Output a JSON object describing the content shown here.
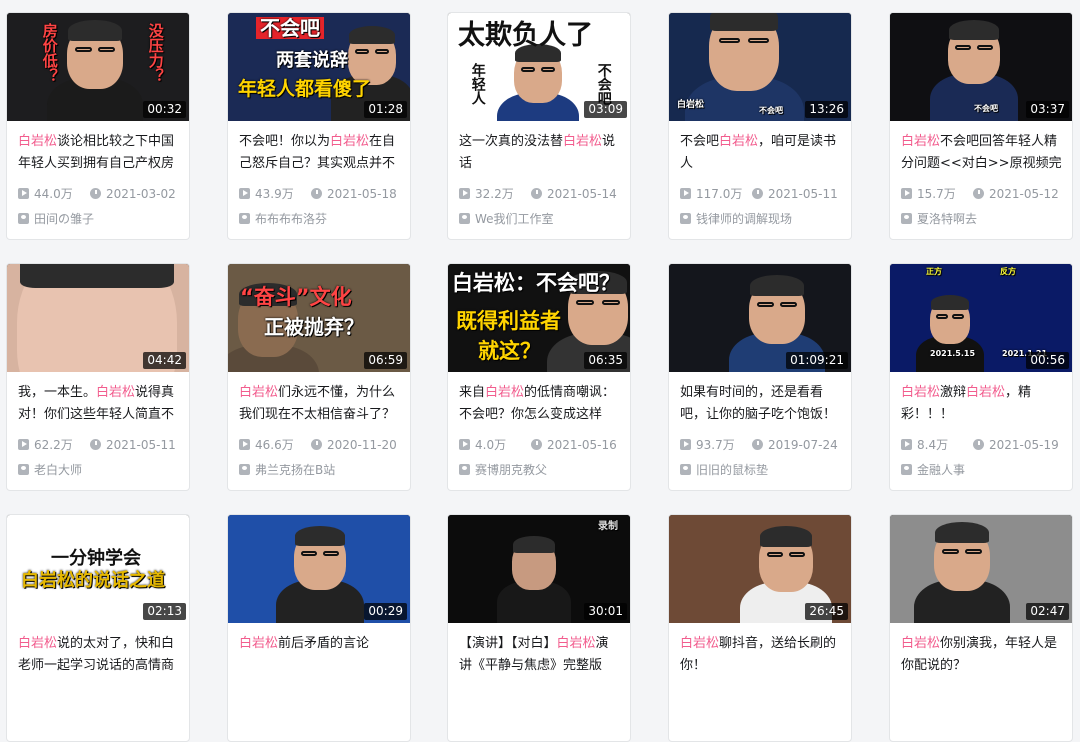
{
  "videos": [
    {
      "title_parts": [
        {
          "t": "白岩松",
          "hl": true
        },
        {
          "t": "谈论相比较之下中国年轻人买到拥有自己产权房",
          "hl": false
        }
      ],
      "views": "44.0万",
      "date": "2021-03-02",
      "uploader": "田间の雏子",
      "duration": "00:32",
      "thumb": {
        "bg": "#1d1d1f",
        "texts": [
          "房价低？",
          "没压力？"
        ]
      }
    },
    {
      "title_parts": [
        {
          "t": "不会吧！你以为",
          "hl": false
        },
        {
          "t": "白岩松",
          "hl": true
        },
        {
          "t": "在自己怒斥自己？其实观点并不",
          "hl": false
        }
      ],
      "views": "43.9万",
      "date": "2021-05-18",
      "uploader": "布布布布洛芬",
      "duration": "01:28",
      "thumb": {
        "bg": "#1b2a55",
        "texts": [
          "不会吧",
          "两套说辞",
          "年轻人都看傻了"
        ]
      }
    },
    {
      "title_parts": [
        {
          "t": "这一次真的没法替",
          "hl": false
        },
        {
          "t": "白岩松",
          "hl": true
        },
        {
          "t": "说话",
          "hl": false
        }
      ],
      "views": "32.2万",
      "date": "2021-05-14",
      "uploader": "We我们工作室",
      "duration": "03:09",
      "thumb": {
        "bg": "#ffffff",
        "texts": [
          "太欺负人了",
          "年轻人",
          "不会吧"
        ]
      }
    },
    {
      "title_parts": [
        {
          "t": "不会吧",
          "hl": false
        },
        {
          "t": "白岩松",
          "hl": true
        },
        {
          "t": "，咱可是读书人",
          "hl": false
        }
      ],
      "views": "117.0万",
      "date": "2021-05-11",
      "uploader": "钱律师的调解现场",
      "duration": "13:26",
      "thumb": {
        "bg": "#16294f",
        "texts": [
          "白岩松",
          "不会吧"
        ]
      }
    },
    {
      "title_parts": [
        {
          "t": "白岩松",
          "hl": true
        },
        {
          "t": "不会吧回答年轻人精分问题<<对白>>原视频完",
          "hl": false
        }
      ],
      "views": "15.7万",
      "date": "2021-05-12",
      "uploader": "夏洛特啊去",
      "duration": "03:37",
      "thumb": {
        "bg": "#0f0f12",
        "texts": [
          "不会吧"
        ]
      }
    },
    {
      "title_parts": [
        {
          "t": "我，一本生。",
          "hl": false
        },
        {
          "t": "白岩松",
          "hl": true
        },
        {
          "t": "说得真对！你们这些年轻人简直不",
          "hl": false
        }
      ],
      "views": "62.2万",
      "date": "2021-05-11",
      "uploader": "老白大师",
      "duration": "04:42",
      "thumb": {
        "bg": "#d7b3a0",
        "texts": []
      }
    },
    {
      "title_parts": [
        {
          "t": "白岩松",
          "hl": true
        },
        {
          "t": "们永远不懂，为什么我们现在不太相信奋斗了？",
          "hl": false
        }
      ],
      "views": "46.6万",
      "date": "2020-11-20",
      "uploader": "弗兰克扬在B站",
      "duration": "06:59",
      "thumb": {
        "bg": "#6b5a45",
        "texts": [
          "“奋斗”文化",
          "正被抛弃？"
        ]
      }
    },
    {
      "title_parts": [
        {
          "t": "来自",
          "hl": false
        },
        {
          "t": "白岩松",
          "hl": true
        },
        {
          "t": "的低情商嘲讽：不会吧？你怎么变成这样",
          "hl": false
        }
      ],
      "views": "4.0万",
      "date": "2021-05-16",
      "uploader": "赛博朋克教父",
      "duration": "06:35",
      "thumb": {
        "bg": "#111111",
        "texts": [
          "白岩松：不会吧？",
          "既得利益者",
          "就这？"
        ]
      }
    },
    {
      "title_parts": [
        {
          "t": "如果有时间的，还是看看吧，让你的脑子吃个饱饭！",
          "hl": false
        }
      ],
      "views": "93.7万",
      "date": "2019-07-24",
      "uploader": "旧旧的鼠标垫",
      "duration": "01:09:21",
      "thumb": {
        "bg": "#14161c",
        "texts": []
      }
    },
    {
      "title_parts": [
        {
          "t": "白岩松",
          "hl": true
        },
        {
          "t": "激辩",
          "hl": false
        },
        {
          "t": "白岩松",
          "hl": true
        },
        {
          "t": "，精彩！！！",
          "hl": false
        }
      ],
      "views": "8.4万",
      "date": "2021-05-19",
      "uploader": "金融人事",
      "duration": "00:56",
      "thumb": {
        "bg": "#0a1a66",
        "texts": [
          "正方",
          "反方",
          "2021.5.15",
          "2021.1.21"
        ]
      }
    },
    {
      "title_parts": [
        {
          "t": "白岩松",
          "hl": true
        },
        {
          "t": "说的太对了，快和白老师一起学习说话的高情商",
          "hl": false
        }
      ],
      "views": "",
      "date": "",
      "uploader": "",
      "duration": "02:13",
      "thumb": {
        "bg": "#ffffff",
        "texts": [
          "一分钟学会",
          "白岩松的说话之道"
        ]
      }
    },
    {
      "title_parts": [
        {
          "t": "白岩松",
          "hl": true
        },
        {
          "t": "前后矛盾的言论",
          "hl": false
        }
      ],
      "views": "",
      "date": "",
      "uploader": "",
      "duration": "00:29",
      "thumb": {
        "bg": "#1f4fa8",
        "texts": []
      }
    },
    {
      "title_parts": [
        {
          "t": "【演讲】【对白】",
          "hl": false
        },
        {
          "t": "白岩松",
          "hl": true
        },
        {
          "t": "演讲《平静与焦虑》完整版",
          "hl": false
        }
      ],
      "views": "",
      "date": "",
      "uploader": "",
      "duration": "30:01",
      "thumb": {
        "bg": "#0c0c0c",
        "texts": [
          "录制"
        ]
      }
    },
    {
      "title_parts": [
        {
          "t": "白岩松",
          "hl": true
        },
        {
          "t": "聊抖音，送给长刷的你！",
          "hl": false
        }
      ],
      "views": "",
      "date": "",
      "uploader": "",
      "duration": "26:45",
      "thumb": {
        "bg": "#6e4a36",
        "texts": []
      }
    },
    {
      "title_parts": [
        {
          "t": "白岩松",
          "hl": true
        },
        {
          "t": "你别演我，年轻人是你配说的？",
          "hl": false
        }
      ],
      "views": "",
      "date": "",
      "uploader": "",
      "duration": "02:47",
      "thumb": {
        "bg": "#8d8d8d",
        "texts": []
      }
    }
  ]
}
